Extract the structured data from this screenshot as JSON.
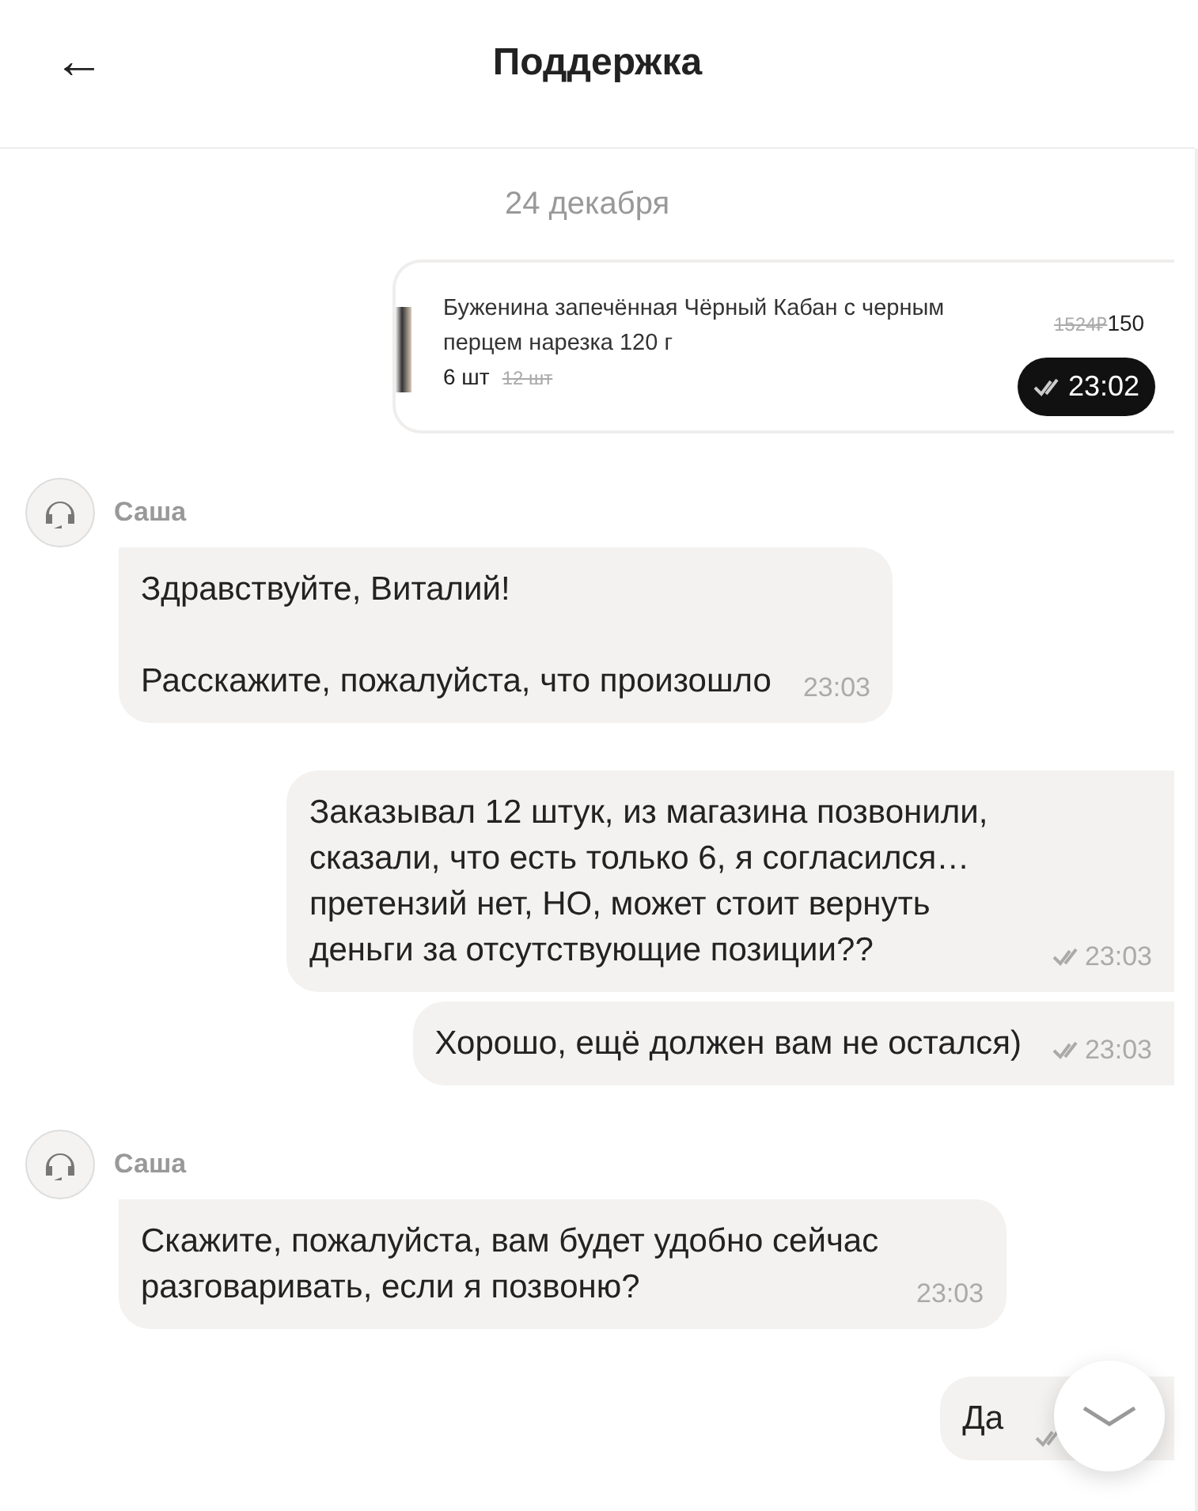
{
  "header": {
    "back_icon": "←",
    "title": "Поддержка"
  },
  "date": "24 декабря",
  "messages": [
    {
      "kind": "product",
      "name": "Буженина запечённая Чёрный Кабан с черным перцем нарезка 120 г",
      "qty": "6 шт",
      "old_qty": "12 шт",
      "old_price": "1524₽",
      "price": "150",
      "time": "23:02",
      "read": true
    },
    {
      "kind": "incoming",
      "sender": "Саша",
      "paragraphs": [
        "Здравствуйте, Виталий!",
        "Расскажите, пожалуйста, что произошло"
      ],
      "time": "23:03"
    },
    {
      "kind": "outgoing",
      "paragraphs": [
        "Заказывал 12 штук, из магазина позвонили, сказали, что есть только 6, я согласился… претензий нет, НО, может стоит вернуть деньги за отсутствующие позиции??"
      ],
      "time": "23:03",
      "read": true
    },
    {
      "kind": "outgoing",
      "paragraphs": [
        "Хорошо, ещё должен вам не остался)"
      ],
      "time": "23:03",
      "read": true
    },
    {
      "kind": "incoming",
      "sender": "Саша",
      "paragraphs": [
        "Скажите, пожалуйста, вам будет удобно сейчас разговаривать, если я позвоню?"
      ],
      "time": "23:03"
    },
    {
      "kind": "outgoing",
      "paragraphs": [
        "Да"
      ],
      "read": true
    }
  ]
}
